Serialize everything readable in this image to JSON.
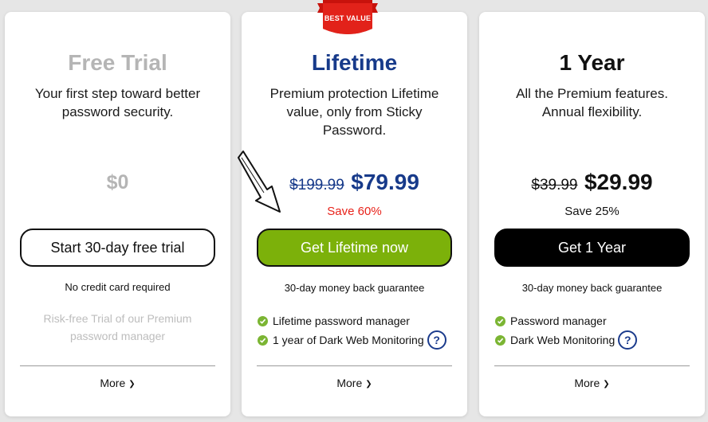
{
  "colors": {
    "brand_blue": "#173a8a",
    "green_cta": "#7cb10a",
    "save_red": "#e8221a",
    "check_green": "#7bb533",
    "muted_gray": "#b5b5b5"
  },
  "cards": {
    "free": {
      "title": "Free Trial",
      "description": "Your first step toward better password security.",
      "price": "$0",
      "cta": "Start 30-day free trial",
      "subtext": "No credit card required",
      "note": "Risk-free Trial of our Premium password manager",
      "more": "More"
    },
    "lifetime": {
      "badge": "BEST VALUE",
      "title": "Lifetime",
      "description": "Premium protection Lifetime value, only from Sticky Password.",
      "old_price": "$199.99",
      "new_price": "$79.99",
      "save": "Save 60%",
      "cta": "Get Lifetime now",
      "subtext": "30-day money back guarantee",
      "features": [
        "Lifetime password manager",
        "1 year of Dark Web Monitoring"
      ],
      "more": "More"
    },
    "year": {
      "title": "1 Year",
      "description": "All the Premium features. Annual flexibility.",
      "old_price": "$39.99",
      "new_price": "$29.99",
      "save": "Save 25%",
      "cta": "Get 1 Year",
      "subtext": "30-day money back guarantee",
      "features": [
        "Password manager",
        "Dark Web Monitoring"
      ],
      "more": "More"
    }
  },
  "icons": {
    "check": "check-circle-icon",
    "help": "question-circle-icon",
    "more": "chevron-down-icon",
    "pointer": "hand-drawn-arrow-icon"
  }
}
